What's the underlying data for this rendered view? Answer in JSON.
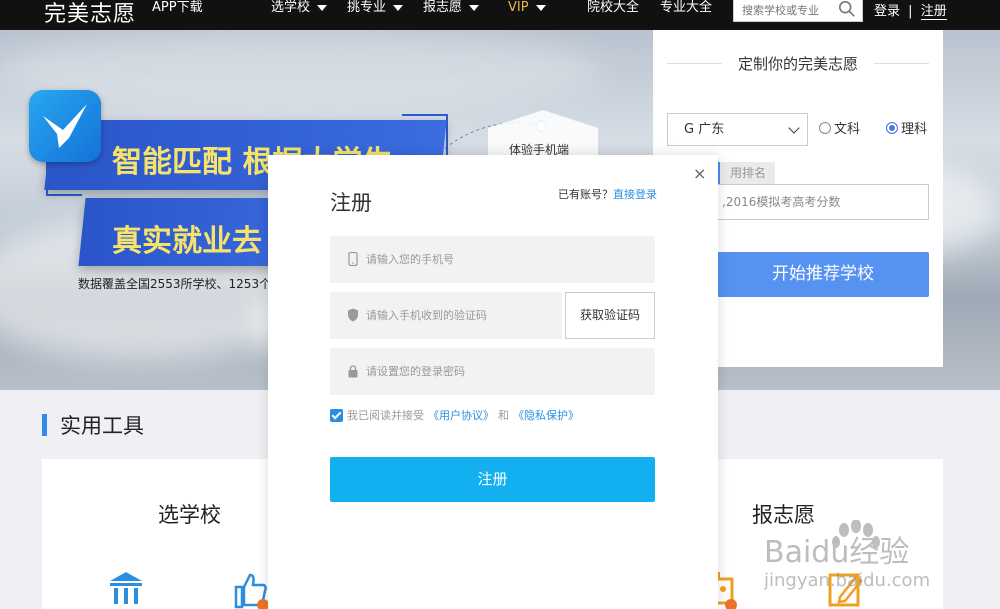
{
  "nav": {
    "logo": "完美志愿",
    "app_download": "APP下载",
    "items": [
      "选学校",
      "挑专业",
      "报志愿",
      "VIP"
    ],
    "links": [
      "院校大全",
      "专业大全"
    ],
    "search_placeholder": "搜索学校或专业",
    "login": "登录",
    "separator": "|",
    "register": "注册"
  },
  "hero": {
    "banner_line1": "智能匹配 根据大学生",
    "banner_line2": "真实就业去",
    "subtext": "数据覆盖全国2553所学校、1253个",
    "phone_badge": "体验手机端"
  },
  "custom_panel": {
    "title": "定制你的完美志愿",
    "province": "G 广东",
    "radio_wenke": "文科",
    "radio_like": "理科",
    "rank_tab": "用排名",
    "score_placeholder": ",2016模拟考高考分数",
    "recommend_button": "开始推荐学校"
  },
  "tools": {
    "title": "实用工具",
    "headings": [
      "选学校",
      "报志愿"
    ]
  },
  "modal": {
    "title": "注册",
    "hint_prefix": "已有账号？",
    "hint_link": "直接登录",
    "close": "×",
    "phone_placeholder": "请输入您的手机号",
    "code_placeholder": "请输入手机收到的验证码",
    "get_code": "获取验证码",
    "password_placeholder": "请设置您的登录密码",
    "agree_prefix": "我已阅读并接受",
    "agreement": "《用户协议》",
    "and": "和",
    "privacy": "《隐私保护》",
    "submit": "注册"
  },
  "watermark": {
    "brand": "Baidu经验",
    "url": "jingyan.baidu.com"
  },
  "colors": {
    "accent": "#12b0f0",
    "panel_button": "#5592f2",
    "vip": "#e9b64c",
    "link": "#2a8fe0"
  }
}
